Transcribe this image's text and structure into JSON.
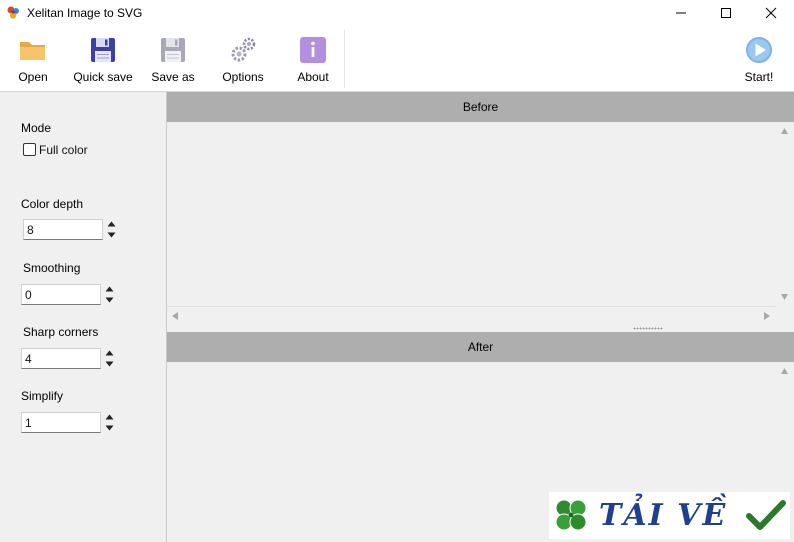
{
  "window": {
    "title": "Xelitan Image to SVG",
    "icon": "paint-splash-icon"
  },
  "toolbar": {
    "open_label": "Open",
    "quick_save_label": "Quick save",
    "save_as_label": "Save as",
    "options_label": "Options",
    "about_label": "About",
    "start_label": "Start!"
  },
  "settings": {
    "mode_label": "Mode",
    "full_color_label": "Full color",
    "full_color_checked": false,
    "color_depth_label": "Color depth",
    "color_depth_value": "8",
    "smoothing_label": "Smoothing",
    "smoothing_value": "0",
    "sharp_corners_label": "Sharp corners",
    "sharp_corners_value": "4",
    "simplify_label": "Simplify",
    "simplify_value": "1"
  },
  "panels": {
    "before_label": "Before",
    "after_label": "After"
  },
  "watermark": {
    "text": "TẢI VỀ",
    "icons": [
      "four-leaf-clover-icon",
      "checkmark-icon"
    ]
  },
  "colors": {
    "header_bar": "#aeaeae",
    "panel_bg": "#f0f0f0",
    "start_icon": "#7ab3e8",
    "about_icon": "#b48ee0",
    "watermark_text": "#1f3f8f",
    "watermark_check": "#2a7a2a",
    "watermark_clover": "#2e8b2e"
  }
}
